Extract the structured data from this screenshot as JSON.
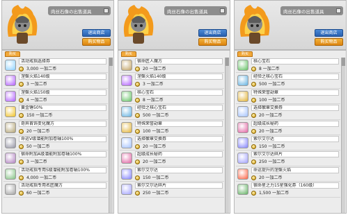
{
  "panels": [
    {
      "profile": {
        "name_text": "肉丝石像の出售道具"
      },
      "buttons": {
        "exit": "退出商店",
        "buy": "购买物品"
      },
      "tab_label": "购买",
      "items": [
        {
          "name": "活动戒指选择券",
          "price": "3,000 一加二币",
          "icon": "ring-coupon-icon",
          "color": "#8ad0ff"
        },
        {
          "name": "涅槃火焰140级",
          "price": "3 一加二币",
          "icon": "purple-flame-icon",
          "color": "#b05cff"
        },
        {
          "name": "涅槃火焰150级",
          "price": "4 一加二币",
          "icon": "purple-flame-icon",
          "color": "#b05cff"
        },
        {
          "name": "黄金锤50%",
          "price": "150 一加二币",
          "icon": "golden-hammer-icon",
          "color": "#f0c020"
        },
        {
          "name": "奇异首饰变化魔方",
          "price": "20 一加二币",
          "icon": "mystery-cube-icon",
          "color": "#b0a070"
        },
        {
          "name": "命运V级潜能附加卷轴100%",
          "price": "50 一加二币",
          "icon": "scroll-icon",
          "color": "#9090a0"
        },
        {
          "name": "宿命附加A级潜能附加卷轴100%",
          "price": "3 一加二币",
          "icon": "scroll-icon",
          "color": "#b080c0"
        },
        {
          "name": "活动戒指专用S级潜能附加卷轴100%",
          "price": "4,000 一加二币",
          "icon": "scroll-icon",
          "color": "#80c080"
        },
        {
          "name": "活动戒指专用名匠魔方",
          "price": "60 一加二币",
          "icon": "cube-icon",
          "color": "#a0a0a0"
        }
      ]
    },
    {
      "profile": {
        "name_text": "肉丝石像の出售道具"
      },
      "buttons": {
        "exit": "退出商店",
        "buy": "购买物品"
      },
      "tab_label": "购买",
      "items": [
        {
          "name": "宿命匠人魔方",
          "price": "20 一加二币",
          "icon": "cube-icon",
          "color": "#c0a060"
        },
        {
          "name": "涅槃火焰140级",
          "price": "3 一加二币",
          "icon": "purple-flame-icon",
          "color": "#b05cff"
        },
        {
          "name": "核心宝石",
          "price": "8 一加二币",
          "icon": "core-gem-icon",
          "color": "#60c060"
        },
        {
          "name": "经验之核心宝石",
          "price": "500 一加二币",
          "icon": "core-gem-icon",
          "color": "#60b0e0"
        },
        {
          "name": "特殊荣誉勋章",
          "price": "100 一加二币",
          "icon": "medal-icon",
          "color": "#e0b030"
        },
        {
          "name": "选择徽章交换券",
          "price": "20 一加二币",
          "icon": "coupon-icon",
          "color": "#a0c0ff"
        },
        {
          "name": "超级成长秘药",
          "price": "20 一加二币",
          "icon": "potion-icon",
          "color": "#e060a0"
        },
        {
          "name": "索尔艾尔达",
          "price": "150 一加二币",
          "icon": "sol-erda-icon",
          "color": "#8080ff"
        },
        {
          "name": "索尔艾尔达碎片",
          "price": "250 一加二币",
          "icon": "sol-erda-fragment-icon",
          "color": "#a0a0ff"
        }
      ]
    },
    {
      "profile": {
        "name_text": "肉丝石像の出售道具"
      },
      "buttons": {
        "exit": "退出商店",
        "buy": "购买物品"
      },
      "tab_label": "购买",
      "items": [
        {
          "name": "核心宝石",
          "price": "8 一加二币",
          "icon": "core-gem-icon",
          "color": "#60c060"
        },
        {
          "name": "经验之核心宝石",
          "price": "500 一加二币",
          "icon": "core-gem-icon",
          "color": "#60b0e0"
        },
        {
          "name": "特殊荣誉勋章",
          "price": "100 一加二币",
          "icon": "medal-icon",
          "color": "#e0b030"
        },
        {
          "name": "选择徽章交换券",
          "price": "20 一加二币",
          "icon": "coupon-icon",
          "color": "#a0c0ff"
        },
        {
          "name": "超级成长秘药",
          "price": "20 一加二币",
          "icon": "potion-icon",
          "color": "#e060a0"
        },
        {
          "name": "索尔艾尔达",
          "price": "150 一加二币",
          "icon": "sol-erda-icon",
          "color": "#8080ff"
        },
        {
          "name": "索尔艾尔达碎片",
          "price": "250 一加二币",
          "icon": "sol-erda-fragment-icon",
          "color": "#a0a0ff"
        },
        {
          "name": "命运提升的涅槃火焰",
          "price": "20 一加二币",
          "icon": "flame-icon",
          "color": "#ff6040"
        },
        {
          "name": "宿命星之力15星强化券（160级）",
          "price": "1,500 一加二币",
          "icon": "starforce-coupon-icon",
          "color": "#60b060"
        }
      ]
    }
  ]
}
